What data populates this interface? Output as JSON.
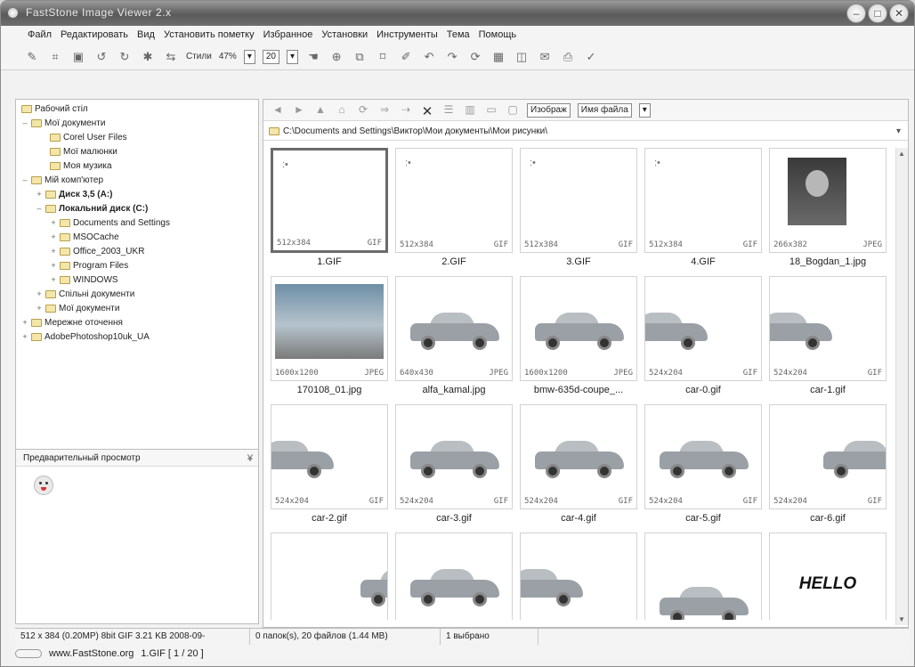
{
  "window": {
    "title": "FastStone Image Viewer 2.x",
    "controls": [
      "minimize",
      "maximize",
      "close"
    ]
  },
  "menu": [
    "Файл",
    "Редактировать",
    "Вид",
    "Установить пометку",
    "Избранное",
    "Установки",
    "Инструменты",
    "Тема",
    "Помощь"
  ],
  "toolbar": {
    "fit_label": "Стили",
    "zoom_value": "47%",
    "count_value": "20"
  },
  "tree": [
    {
      "label": "Рабочий стіл",
      "level": 0
    },
    {
      "label": "Мої документи",
      "level": 1
    },
    {
      "label": "Corel User Files",
      "level": 2
    },
    {
      "label": "Мої малюнки",
      "level": 2
    },
    {
      "label": "Моя музика",
      "level": 2
    },
    {
      "label": "Мій комп'ютер",
      "level": 1
    },
    {
      "label": "Диск 3,5 (A:)",
      "level": 2,
      "bold": true
    },
    {
      "label": "Локальний диск (C:)",
      "level": 2,
      "bold": true
    },
    {
      "label": "Documents and Settings",
      "level": 3
    },
    {
      "label": "MSOCache",
      "level": 3
    },
    {
      "label": "Office_2003_UKR",
      "level": 3
    },
    {
      "label": "Program Files",
      "level": 3
    },
    {
      "label": "WINDOWS",
      "level": 3
    },
    {
      "label": "Спільні документи",
      "level": 2
    },
    {
      "label": "Мої документи",
      "level": 2
    },
    {
      "label": "Мережне оточення",
      "level": 1
    },
    {
      "label": "AdobePhotoshop10uk_UA",
      "level": 1
    }
  ],
  "preview": {
    "title": "Предварительный просмотр"
  },
  "browser": {
    "toolbar_sort_view": "Изображ",
    "toolbar_sort_by": "Имя файла",
    "path": "C:\\Documents and Settings\\Виктор\\Мои документы\\Мои рисунки\\"
  },
  "thumbnails": [
    {
      "name": "1.GIF",
      "dims": "512x384",
      "type": "GIF",
      "kind": "face",
      "selected": true
    },
    {
      "name": "2.GIF",
      "dims": "512x384",
      "type": "GIF",
      "kind": "face"
    },
    {
      "name": "3.GIF",
      "dims": "512x384",
      "type": "GIF",
      "kind": "face"
    },
    {
      "name": "4.GIF",
      "dims": "512x384",
      "type": "GIF",
      "kind": "face"
    },
    {
      "name": "18_Bogdan_1.jpg",
      "dims": "266x382",
      "type": "JPEG",
      "kind": "photo"
    },
    {
      "name": "170108_01.jpg",
      "dims": "1600x1200",
      "type": "JPEG",
      "kind": "landscape"
    },
    {
      "name": "alfa_kamal.jpg",
      "dims": "640x430",
      "type": "JPEG",
      "kind": "car"
    },
    {
      "name": "bmw-635d-coupe_...",
      "dims": "1600x1200",
      "type": "JPEG",
      "kind": "car"
    },
    {
      "name": "car-0.gif",
      "dims": "524x204",
      "type": "GIF",
      "kind": "car-cut"
    },
    {
      "name": "car-1.gif",
      "dims": "524x204",
      "type": "GIF",
      "kind": "car-cut"
    },
    {
      "name": "car-2.gif",
      "dims": "524x204",
      "type": "GIF",
      "kind": "car-cut"
    },
    {
      "name": "car-3.gif",
      "dims": "524x204",
      "type": "GIF",
      "kind": "car"
    },
    {
      "name": "car-4.gif",
      "dims": "524x204",
      "type": "GIF",
      "kind": "car"
    },
    {
      "name": "car-5.gif",
      "dims": "524x204",
      "type": "GIF",
      "kind": "car"
    },
    {
      "name": "car-6.gif",
      "dims": "524x204",
      "type": "GIF",
      "kind": "car-cut"
    },
    {
      "name": "",
      "dims": "",
      "type": "",
      "kind": "car-cut"
    },
    {
      "name": "",
      "dims": "",
      "type": "",
      "kind": "car"
    },
    {
      "name": "",
      "dims": "",
      "type": "",
      "kind": "car-cut"
    },
    {
      "name": "",
      "dims": "",
      "type": "",
      "kind": "car"
    },
    {
      "name": "",
      "dims": "",
      "type": "",
      "kind": "hello",
      "text": "HELLO"
    }
  ],
  "status": {
    "image_info": "512 x 384 (0.20MP)  8bit GIF  3.21 KB  2008-09-",
    "folder_info": "0 папок(s), 20 файлов (1.44 MB)",
    "selected": "1 выбрано",
    "site": "www.FastStone.org",
    "counter": "1.GIF [ 1 / 20 ]"
  }
}
